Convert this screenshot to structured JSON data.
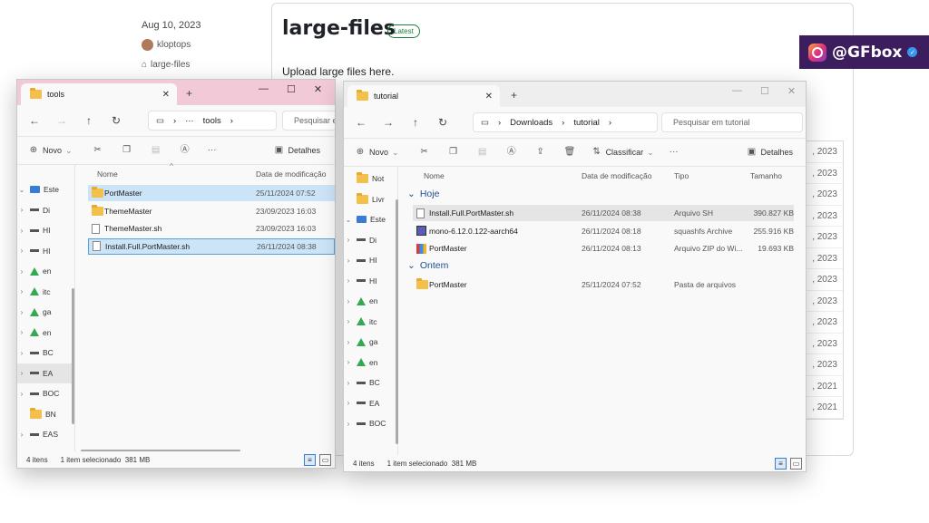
{
  "background": {
    "date": "Aug 10, 2023",
    "user": "kloptops",
    "tag": "large-files",
    "title": "large-files",
    "badge": "Latest",
    "description": "Upload large files here.",
    "right_dates": [
      ", 2023",
      ", 2023",
      ", 2023",
      ", 2023",
      ", 2023",
      ", 2023",
      ", 2023",
      ", 2023",
      ", 2023",
      ", 2023",
      ", 2023",
      ", 2021",
      ", 2021"
    ]
  },
  "watermark": {
    "handle": "@GFbox",
    "icon": "instagram-icon"
  },
  "window_tools": {
    "tab_title": "tools",
    "breadcrumb": [
      "···",
      "tools"
    ],
    "search_placeholder": "Pesquisar e",
    "commands": {
      "new": "Novo",
      "details": "Detalhes"
    },
    "columns": {
      "name": "Nome",
      "modified": "Data de modificação"
    },
    "nav_items": [
      {
        "label": "Este",
        "icon": "monitor"
      },
      {
        "label": "Di",
        "icon": "drive"
      },
      {
        "label": "HI",
        "icon": "drive"
      },
      {
        "label": "HI",
        "icon": "drive"
      },
      {
        "label": "en",
        "icon": "gdrive"
      },
      {
        "label": "itc",
        "icon": "gdrive"
      },
      {
        "label": "ga",
        "icon": "gdrive"
      },
      {
        "label": "en",
        "icon": "gdrive"
      },
      {
        "label": "BC",
        "icon": "drive"
      },
      {
        "label": "EA",
        "icon": "drive"
      },
      {
        "label": "BOC",
        "icon": "drive"
      },
      {
        "label": "BN",
        "icon": "folder"
      },
      {
        "label": "EAS",
        "icon": "drive"
      }
    ],
    "files": [
      {
        "name": "PortMaster",
        "modified": "25/11/2024 07:52",
        "type": "folder"
      },
      {
        "name": "ThemeMaster",
        "modified": "23/09/2023 16:03",
        "type": "folder"
      },
      {
        "name": "ThemeMaster.sh",
        "modified": "23/09/2023 16:03",
        "type": "file"
      },
      {
        "name": "Install.Full.PortMaster.sh",
        "modified": "26/11/2024 08:38",
        "type": "file"
      }
    ],
    "status": {
      "count": "4 itens",
      "selection": "1 item selecionado",
      "size": "381 MB"
    }
  },
  "window_tutorial": {
    "tab_title": "tutorial",
    "breadcrumb": [
      "Downloads",
      "tutorial"
    ],
    "search_placeholder": "Pesquisar em tutorial",
    "commands": {
      "new": "Novo",
      "sort": "Classificar",
      "details": "Detalhes"
    },
    "columns": {
      "name": "Nome",
      "modified": "Data de modificação",
      "type": "Tipo",
      "size": "Tamanho"
    },
    "nav_items": [
      {
        "label": "Not",
        "icon": "folder"
      },
      {
        "label": "Livr",
        "icon": "folder"
      },
      {
        "label": "Este",
        "icon": "monitor"
      },
      {
        "label": "Di",
        "icon": "drive"
      },
      {
        "label": "HI",
        "icon": "drive"
      },
      {
        "label": "HI",
        "icon": "drive"
      },
      {
        "label": "en",
        "icon": "gdrive"
      },
      {
        "label": "itc",
        "icon": "gdrive"
      },
      {
        "label": "ga",
        "icon": "gdrive"
      },
      {
        "label": "en",
        "icon": "gdrive"
      },
      {
        "label": "BC",
        "icon": "drive"
      },
      {
        "label": "EA",
        "icon": "drive"
      },
      {
        "label": "BOC",
        "icon": "drive"
      }
    ],
    "groups": [
      {
        "label": "Hoje",
        "files": [
          {
            "name": "Install.Full.PortMaster.sh",
            "modified": "26/11/2024 08:38",
            "type": "Arquivo SH",
            "size": "390.827 KB",
            "icon": "file"
          },
          {
            "name": "mono-6.12.0.122-aarch64",
            "modified": "26/11/2024 08:18",
            "type": "squashfs Archive",
            "size": "255.916 KB",
            "icon": "squashfs"
          },
          {
            "name": "PortMaster",
            "modified": "26/11/2024 08:13",
            "type": "Arquivo ZIP do Wi...",
            "size": "19.693 KB",
            "icon": "zip"
          }
        ]
      },
      {
        "label": "Ontem",
        "files": [
          {
            "name": "PortMaster",
            "modified": "25/11/2024 07:52",
            "type": "Pasta de arquivos",
            "size": "",
            "icon": "folder"
          }
        ]
      }
    ],
    "status": {
      "count": "4 itens",
      "selection": "1 item selecionado",
      "size": "381 MB"
    }
  }
}
